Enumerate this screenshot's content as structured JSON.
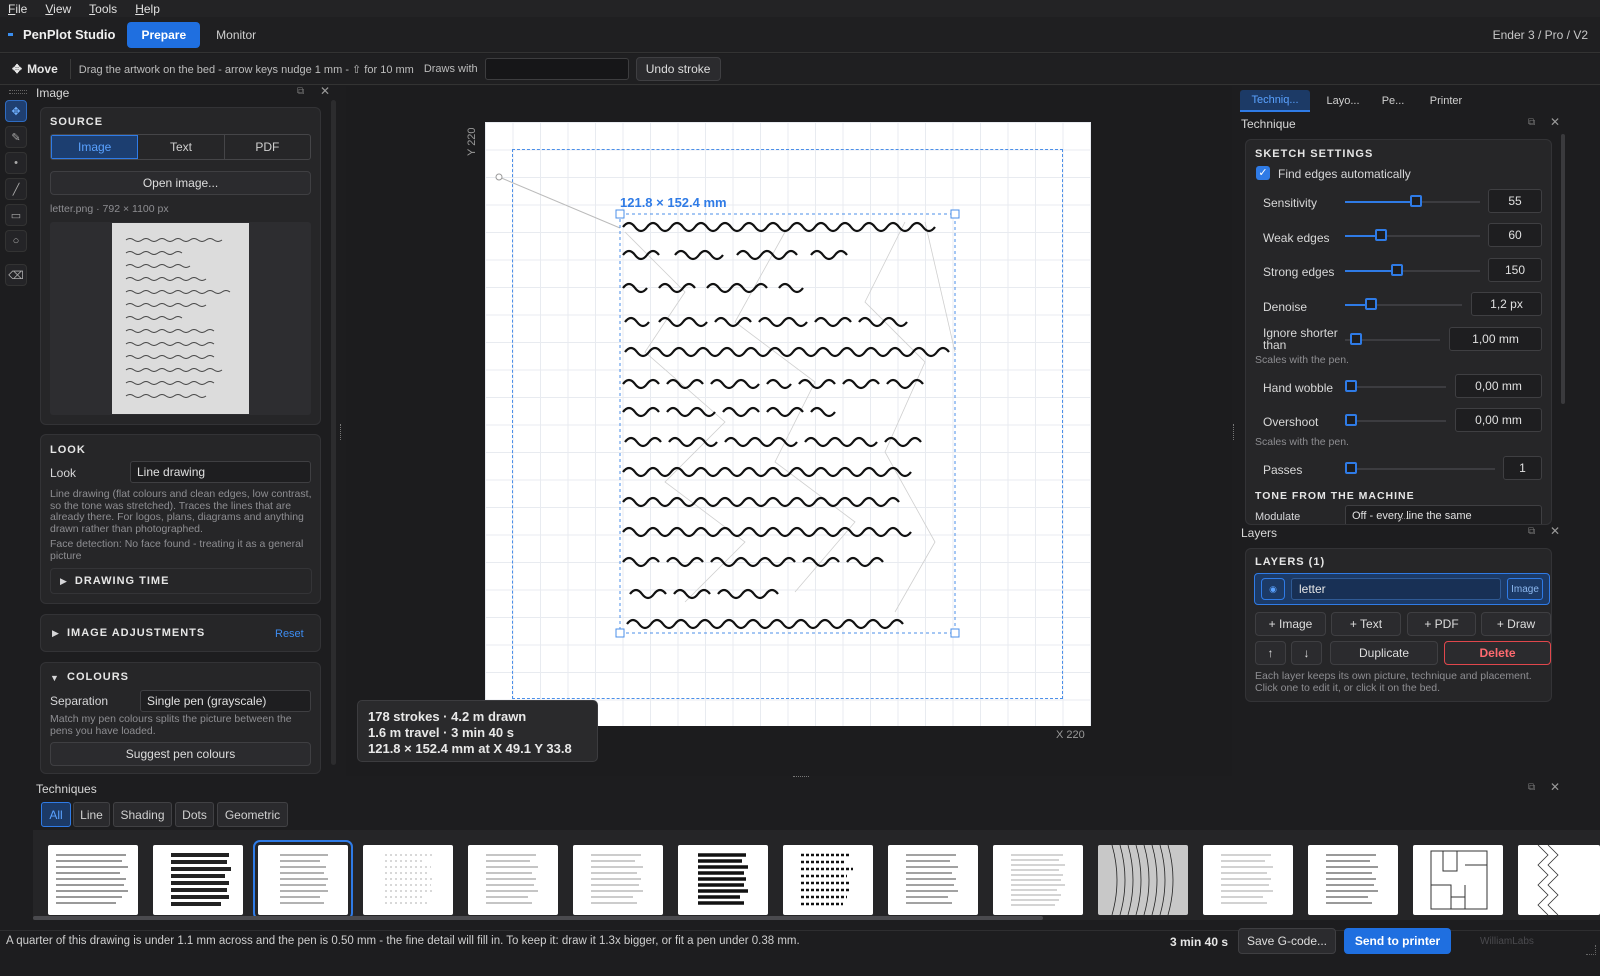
{
  "menu": [
    "File",
    "View",
    "Tools",
    "Help"
  ],
  "app": {
    "title": "PenPlot Studio",
    "modes": [
      "Prepare",
      "Monitor"
    ],
    "printer": "Ender 3 / Pro / V2"
  },
  "toolbar": {
    "tool": "Move",
    "hint": "Drag the artwork on the bed - arrow keys nudge 1 mm - ⇧ for 10 mm",
    "draws_with_label": "Draws with",
    "undo_label": "Undo stroke"
  },
  "left_panel": {
    "title": "Image",
    "source": {
      "heading": "SOURCE",
      "tabs": [
        "Image",
        "Text",
        "PDF"
      ],
      "open_label": "Open image...",
      "file_info": "letter.png · 792 × 1100 px"
    },
    "look": {
      "heading": "LOOK",
      "label": "Look",
      "value": "Line drawing",
      "description": "Line drawing (flat colours and clean edges, low contrast, so the tone was stretched). Traces the lines that are already there. For logos, plans, diagrams and anything drawn rather than photographed.",
      "face_note": "Face detection: No face found - treating it as a general picture",
      "drawing_time": "DRAWING TIME"
    },
    "adjustments": {
      "heading": "IMAGE ADJUSTMENTS",
      "reset": "Reset"
    },
    "colours": {
      "heading": "COLOURS",
      "label": "Separation",
      "value": "Single pen (grayscale)",
      "description": "Match my pen colours splits the picture between the pens you have loaded.",
      "suggest": "Suggest pen colours"
    }
  },
  "canvas": {
    "y_axis": "Y 220",
    "x_axis": "X 220",
    "dimension_label": "121.8 × 152.4 mm",
    "stats": {
      "line1": "178 strokes  ·  4.2 m drawn",
      "line2": "1.6 m travel  ·  3 min 40 s",
      "line3": "121.8 × 152.4 mm at X 49.1  Y 33.8"
    }
  },
  "right_panel": {
    "tabs": [
      "Techniq...",
      "Layo...",
      "Pe...",
      "Printer"
    ],
    "title": "Technique",
    "sketch": {
      "heading": "SKETCH SETTINGS",
      "auto_edges": "Find edges automatically",
      "params": [
        {
          "label": "Sensitivity",
          "value": "55",
          "level": 0.53
        },
        {
          "label": "Weak edges",
          "value": "60",
          "level": 0.27
        },
        {
          "label": "Strong edges",
          "value": "150",
          "level": 0.38
        },
        {
          "label": "Denoise",
          "value": "1,2 px",
          "level": 0.2
        },
        {
          "label": "Ignore shorter than",
          "value": "1,00 mm",
          "level": 0.05
        },
        {
          "label": "Hand wobble",
          "value": "0,00 mm",
          "level": 0.0
        },
        {
          "label": "Overshoot",
          "value": "0,00 mm",
          "level": 0.0
        },
        {
          "label": "Passes",
          "value": "1",
          "level": 0.0
        }
      ],
      "scales_note": "Scales with the pen.",
      "tone_heading": "TONE FROM THE MACHINE",
      "modulate_label": "Modulate",
      "modulate_value": "Off - every line the same"
    },
    "layers": {
      "title": "Layers",
      "heading": "LAYERS  (1)",
      "layer_name": "letter",
      "layer_type": "Image",
      "add_buttons": [
        "+ Image",
        "+ Text",
        "+ PDF",
        "+ Draw"
      ],
      "up": "↑",
      "down": "↓",
      "duplicate": "Duplicate",
      "delete": "Delete",
      "note": "Each layer keeps its own picture, technique and placement. Click one to edit it, or click it on the bed."
    }
  },
  "techniques": {
    "title": "Techniques",
    "tabs": [
      "All",
      "Line",
      "Shading",
      "Dots",
      "Geometric"
    ]
  },
  "status": {
    "message": "A quarter of this drawing is under 1.1 mm across and the pen is 0.50 mm - the fine detail will fill in. To keep it: draw it 1.3x bigger, or fit a pen under 0.38 mm.",
    "time": "3 min 40 s",
    "save": "Save G-code...",
    "send": "Send to printer",
    "brand": "WilliamLabs"
  },
  "colors": {
    "accent": "#1f6fe0",
    "danger": "#e0474c",
    "panel": "#262628"
  }
}
